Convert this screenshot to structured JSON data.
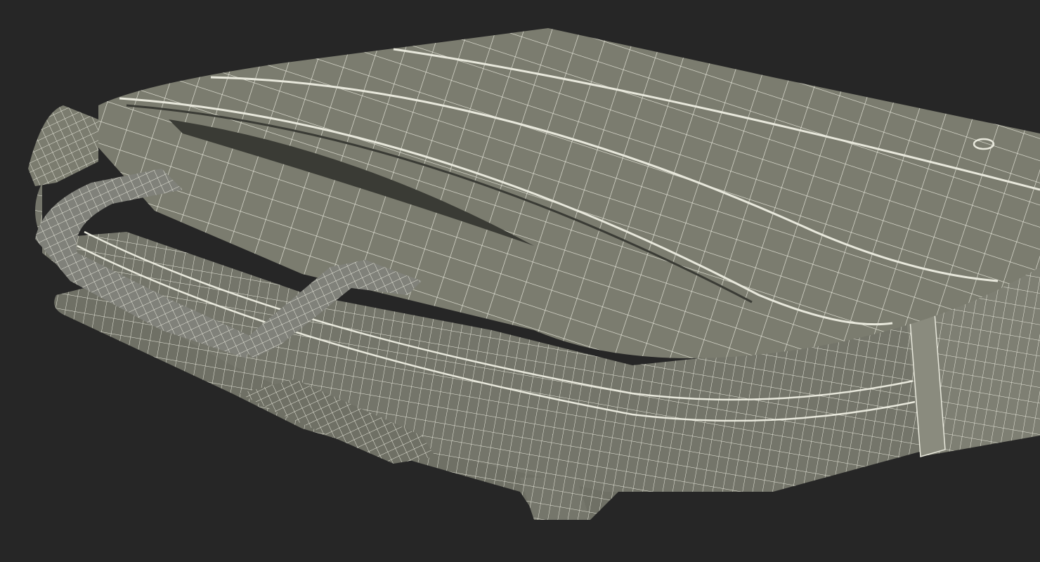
{
  "scene": {
    "subject": "laptop-bag-wireframe",
    "colors": {
      "background": "#262626",
      "surface": "#7b7c6f",
      "surface_light": "#8a8b7e",
      "surface_dark": "#5f6056",
      "shadow": "#3a3b35",
      "wire": "#e8e8dc"
    }
  }
}
